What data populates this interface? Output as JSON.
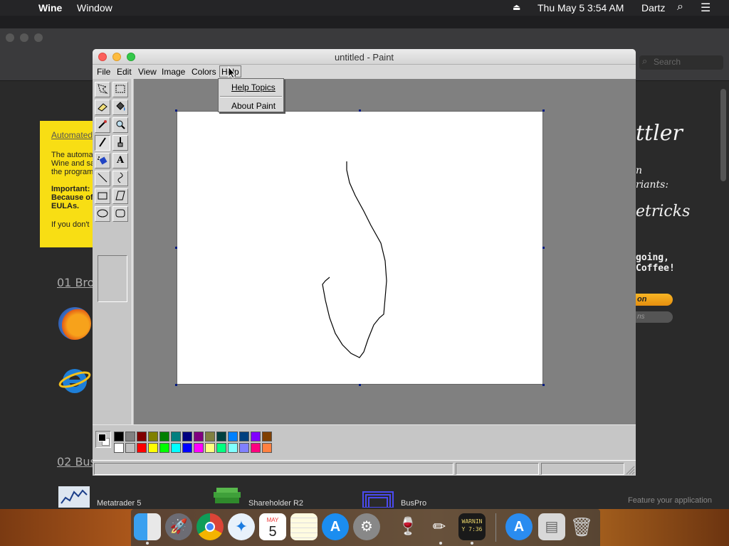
{
  "menubar": {
    "app": "Wine",
    "menu": "Window",
    "datetime": "Thu May 5  3:54 AM",
    "user": "Dartz"
  },
  "background": {
    "search_placeholder": "Search",
    "notice": {
      "title": "Automated",
      "p1": "The automa",
      "p2": "Wine and sa",
      "p3": "the program",
      "p4": "Important:",
      "p5": "Because of",
      "p6": "EULAs.",
      "p7": "If you don't"
    },
    "section1": "01 Brov",
    "section2": "02 Bus",
    "right_title": "ttler",
    "right_sub1": "n",
    "right_sub2": "riants:",
    "right_mid": "etricks",
    "right_mono1": "going,",
    "right_mono2": "Coffee!",
    "btn_orange": "on",
    "btn_gray": "ns",
    "feature": "Feature your application",
    "apps": [
      "Metatrader 5",
      "Shareholder R2",
      "BusPro"
    ]
  },
  "paint": {
    "title": "untitled - Paint",
    "menus": [
      "File",
      "Edit",
      "View",
      "Image",
      "Colors",
      "Help"
    ],
    "help_menu": [
      "Help Topics",
      "About Paint"
    ],
    "tools": [
      "free-select",
      "rect-select",
      "eraser",
      "fill",
      "color-picker",
      "magnifier",
      "pencil",
      "brush",
      "airbrush",
      "text",
      "line",
      "curve",
      "rectangle",
      "polygon",
      "ellipse",
      "rounded-rect"
    ],
    "palette_top": [
      "#000000",
      "#808080",
      "#800000",
      "#808000",
      "#008000",
      "#008080",
      "#000080",
      "#800080",
      "#808040",
      "#004040",
      "#0080ff",
      "#004080",
      "#8000ff",
      "#804000"
    ],
    "palette_bottom": [
      "#ffffff",
      "#c0c0c0",
      "#ff0000",
      "#ffff00",
      "#00ff00",
      "#00ffff",
      "#0000ff",
      "#ff00ff",
      "#ffff80",
      "#00ff80",
      "#80ffff",
      "#8080ff",
      "#ff0080",
      "#ff8040"
    ]
  },
  "dock": {
    "calendar_month": "MAY",
    "calendar_day": "5",
    "console_text1": "WARNIN",
    "console_text2": "Y 7:36"
  }
}
